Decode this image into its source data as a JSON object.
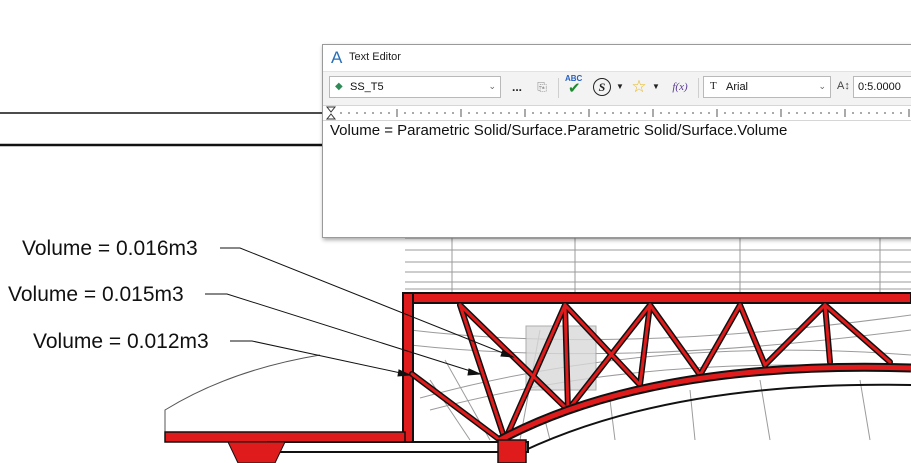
{
  "drawing": {
    "callouts": [
      {
        "text": "Volume = 0.016m3"
      },
      {
        "text": "Volume = 0.015m3"
      },
      {
        "text": "Volume = 0.012m3"
      }
    ],
    "colors": {
      "member_fill": "#e01b1b",
      "outline": "#111111",
      "ghost_lines": "#9b9b9b"
    }
  },
  "text_editor": {
    "title": "Text Editor",
    "title_icon": "autodesk-a-icon",
    "toolbar": {
      "text_style": "SS_T5",
      "more_label": "...",
      "spell_label": "ABC",
      "symbol_label": "S",
      "field_label": "f(x)",
      "font": "Arial",
      "font_icon_label": "T",
      "text_height": "0:5.0000",
      "icons": [
        "diamond-style-icon",
        "more-icon",
        "paste-icon",
        "spell-check-icon",
        "symbol-icon",
        "star-icon",
        "field-icon",
        "font-icon",
        "text-height-icon"
      ]
    },
    "content": "Volume = Parametric Solid/Surface.Parametric Solid/Surface.Volume",
    "colors": {
      "title_logo": "#2a6fb5",
      "toolbar_bg": "#f3f3f3"
    }
  }
}
